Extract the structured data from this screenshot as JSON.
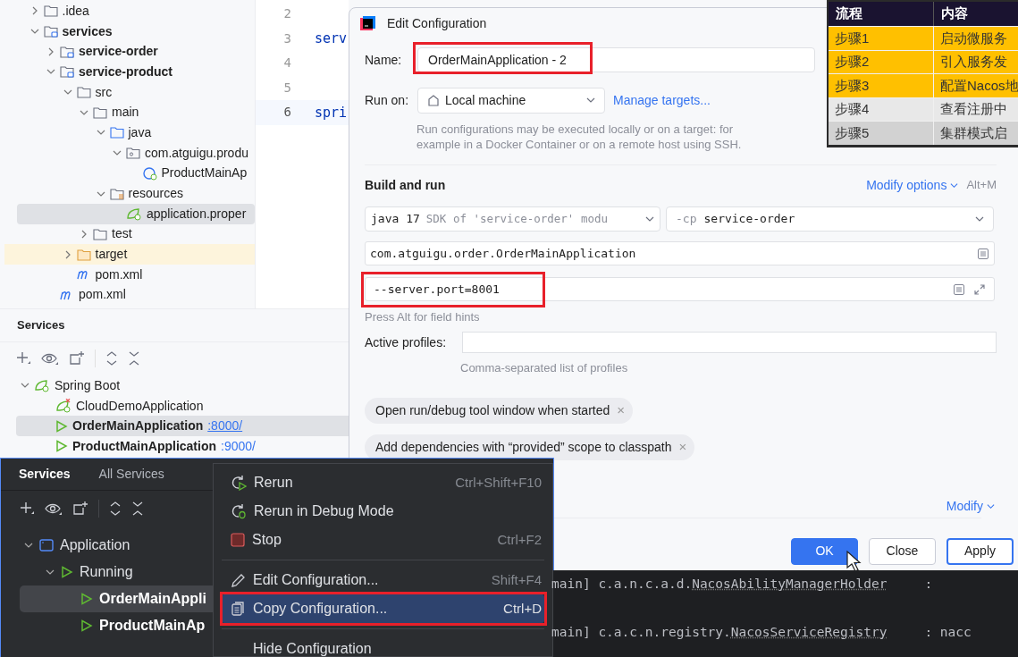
{
  "project_tree": [
    {
      "label": ".idea",
      "kind": "folder",
      "expanded": false,
      "selected": false
    },
    {
      "label": "services",
      "kind": "module",
      "expanded": true,
      "selected": false,
      "children": [
        {
          "label": "service-order",
          "kind": "module",
          "expanded": false,
          "selected": false
        },
        {
          "label": "service-product",
          "kind": "module",
          "expanded": true,
          "selected": false,
          "children": [
            {
              "label": "src",
              "kind": "folder",
              "expanded": true,
              "selected": false,
              "children": [
                {
                  "label": "main",
                  "kind": "folder",
                  "expanded": true,
                  "selected": false,
                  "children": [
                    {
                      "label": "java",
                      "kind": "source-folder",
                      "expanded": true,
                      "selected": false,
                      "children": [
                        {
                          "label": "com.atguigu.produ",
                          "kind": "package",
                          "expanded": true,
                          "selected": false,
                          "children": [
                            {
                              "label": "ProductMainAp",
                              "kind": "spring-class",
                              "selected": false
                            }
                          ]
                        }
                      ]
                    },
                    {
                      "label": "resources",
                      "kind": "resources-folder",
                      "expanded": true,
                      "selected": false,
                      "children": [
                        {
                          "label": "application.proper",
                          "kind": "spring-config",
                          "selected": true
                        }
                      ]
                    }
                  ]
                },
                {
                  "label": "test",
                  "kind": "folder",
                  "expanded": false,
                  "selected": false
                }
              ]
            },
            {
              "label": "target",
              "kind": "excluded-folder",
              "expanded": false,
              "selected": false
            },
            {
              "label": "pom.xml",
              "kind": "maven",
              "selected": false
            }
          ]
        },
        {
          "label": "pom.xml",
          "kind": "maven",
          "selected": false
        }
      ]
    }
  ],
  "editor": {
    "lines": [
      {
        "number": "2"
      },
      {
        "number": "3",
        "code": "serv"
      },
      {
        "number": "4"
      },
      {
        "number": "5"
      },
      {
        "number": "6",
        "code": "spri",
        "current": true
      }
    ]
  },
  "services_panel": {
    "title": "Services",
    "tree": [
      {
        "label": "Spring Boot",
        "kind": "spring",
        "expanded": true,
        "selected": false,
        "children": [
          {
            "label": "CloudDemoApplication",
            "kind": "spring-error",
            "selected": false
          },
          {
            "label": "OrderMainApplication",
            "port": ":8000/",
            "kind": "running",
            "selected": true
          },
          {
            "label": "ProductMainApplication",
            "port": ":9000/",
            "kind": "running",
            "selected": false
          }
        ]
      }
    ]
  },
  "dialog": {
    "title": "Edit Configuration",
    "name_label": "Name:",
    "name_value": "OrderMainApplication - 2",
    "name_highlighted": true,
    "run_on_label": "Run on:",
    "run_on_value": "Local machine",
    "manage_targets": "Manage targets...",
    "run_on_hint": "Run configurations may be executed locally or on a target: for example in a Docker Container or on a remote host using SSH.",
    "section_title": "Build and run",
    "modify_options": "Modify options",
    "modify_options_shortcut": "Alt+M",
    "jdk": {
      "value": "java 17",
      "detail": "SDK of 'service-order' modu"
    },
    "classpath": {
      "flag": "-cp",
      "value": "service-order"
    },
    "main_class": "com.atguigu.order.OrderMainApplication",
    "program_args": "--server.port=8001",
    "program_args_highlighted": true,
    "field_hint": "Press Alt for field hints",
    "profiles_label": "Active profiles:",
    "profiles_hint": "Comma-separated list of profiles",
    "options": [
      {
        "label": "Open run/debug tool window when started",
        "close": "×"
      },
      {
        "label": "Add dependencies with “provided” scope to classpath",
        "close": "×"
      }
    ],
    "modify": "Modify",
    "buttons": [
      {
        "label": "OK",
        "kind": "primary"
      },
      {
        "label": "Close",
        "kind": "normal"
      },
      {
        "label": "Apply",
        "kind": "focused"
      }
    ]
  },
  "steps_table": {
    "columns": [
      "流程",
      "内容"
    ],
    "rows": [
      {
        "step": "步骤1",
        "content": "启动微服务",
        "color": "#ffc000"
      },
      {
        "step": "步骤2",
        "content": "引入服务发",
        "color": "#ffc000"
      },
      {
        "step": "步骤3",
        "content": "配置Nacos地",
        "color": "#ffc000"
      },
      {
        "step": "步骤4",
        "content": "查看注册中",
        "color": "#e8e8e8"
      },
      {
        "step": "步骤5",
        "content": "集群模式启",
        "color": "#d2d2d2"
      }
    ]
  },
  "dark_services": {
    "tabs": [
      {
        "label": "Services",
        "selected": true
      },
      {
        "label": "All Services",
        "selected": false
      }
    ],
    "tree": [
      {
        "label": "Application",
        "kind": "application",
        "expanded": true,
        "selected": false,
        "children": [
          {
            "label": "Running",
            "kind": "running",
            "expanded": true,
            "selected": false,
            "children": [
              {
                "label": "OrderMainAppli",
                "kind": "running",
                "selected": true
              },
              {
                "label": "ProductMainAp",
                "kind": "running",
                "selected": false
              }
            ]
          }
        ]
      }
    ]
  },
  "context_menu": [
    {
      "label": "Rerun",
      "shortcut": "Ctrl+Shift+F10",
      "kind": "rerun",
      "selected": false
    },
    {
      "label": "Rerun in Debug Mode",
      "kind": "debug",
      "selected": false
    },
    {
      "label": "Stop",
      "shortcut": "Ctrl+F2",
      "kind": "stop",
      "selected": false,
      "separator_after": true
    },
    {
      "label": "Edit Configuration...",
      "shortcut": "Shift+F4",
      "kind": "edit",
      "selected": false
    },
    {
      "label": "Copy Configuration...",
      "shortcut": "Ctrl+D",
      "kind": "copy",
      "selected": true,
      "highlighted": true,
      "separator_after": true
    },
    {
      "label": "Hide Configuration",
      "kind": "plain",
      "selected": false
    }
  ],
  "console": [
    {
      "thread": "main]",
      "logger_prefix": "c.a.n.c.a.d.",
      "logger": "NacosAbilityManagerHolder",
      "message": ":"
    },
    {
      "thread": "main]",
      "logger_prefix": "c.a.c.n.registry.",
      "logger": "NacosServiceRegistry",
      "message": ": nacc"
    }
  ]
}
